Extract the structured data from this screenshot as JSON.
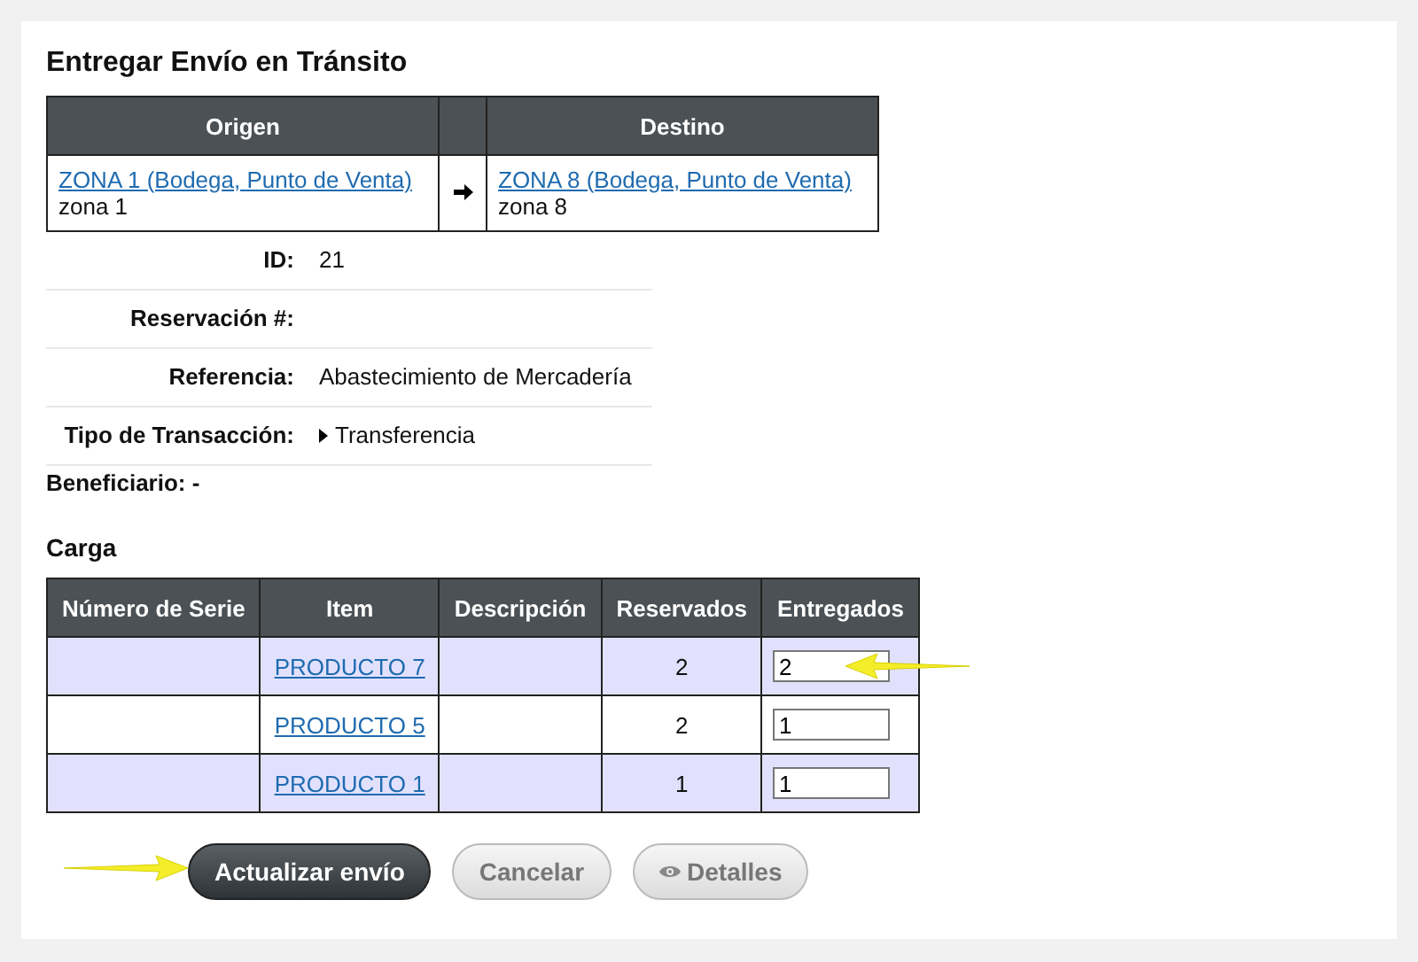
{
  "title": "Entregar Envío en Tránsito",
  "route": {
    "columns": [
      "Origen",
      "Destino"
    ],
    "origin": {
      "link": "ZONA 1 (Bodega, Punto de Venta)",
      "note": "zona 1"
    },
    "destination": {
      "link": "ZONA 8 (Bodega, Punto de Venta)",
      "note": "zona 8"
    }
  },
  "details": [
    {
      "label": "ID:",
      "value": "21"
    },
    {
      "label": "Reservación #:"
    },
    {
      "label": "Referencia:",
      "value": "Abastecimiento de Mercadería"
    },
    {
      "label": "Tipo de Transacción:",
      "value": "Transferencia",
      "kind": "expandable"
    }
  ],
  "beneficiary": "Beneficiario: -",
  "cargo": {
    "title": "Carga",
    "columns": [
      "Número de Serie",
      "Item",
      "Descripción",
      "Reservados",
      "Entregados"
    ],
    "rows": [
      {
        "item": "PRODUCTO 7",
        "reserved": "2",
        "delivered": "2"
      },
      {
        "item": "PRODUCTO 5",
        "reserved": "2",
        "delivered": "1"
      },
      {
        "item": "PRODUCTO 1",
        "reserved": "1",
        "delivered": "1"
      }
    ]
  },
  "buttons": [
    {
      "label": "Actualizar envío",
      "kind": "primary"
    },
    {
      "label": "Cancelar",
      "kind": "secondary"
    },
    {
      "label": "Detalles",
      "kind": "details"
    }
  ]
}
